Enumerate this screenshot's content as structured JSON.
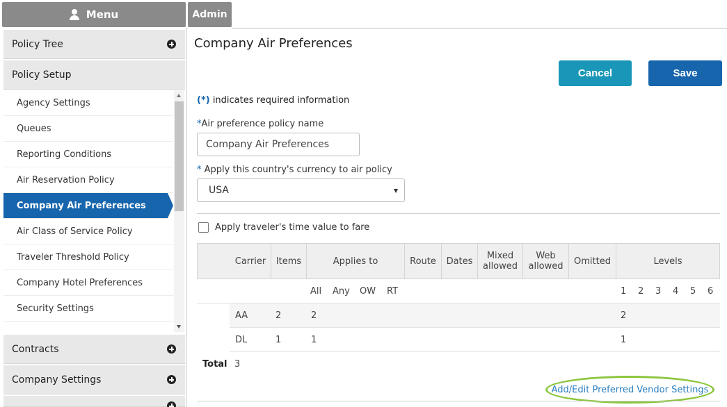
{
  "top": {
    "menu_label": "Menu",
    "admin_label": "Admin"
  },
  "sidebar": {
    "policy_tree": "Policy Tree",
    "policy_setup": "Policy Setup",
    "items": [
      "Agency Settings",
      "Queues",
      "Reporting Conditions",
      "Air Reservation Policy",
      "Company Air Preferences",
      "Air Class of Service Policy",
      "Traveler Threshold Policy",
      "Company Hotel Preferences",
      "Security Settings"
    ],
    "active_item": "Company Air Preferences",
    "contracts": "Contracts",
    "company_settings": "Company Settings"
  },
  "main": {
    "title": "Company Air Preferences",
    "cancel_label": "Cancel",
    "save_label": "Save",
    "required_star": "(*)",
    "required_note": " indicates required information",
    "policy_name_label": "Air preference policy name",
    "policy_name_value": "Company Air Preferences",
    "currency_label": " Apply this country's currency to air policy",
    "currency_value": "USA",
    "time_value_label": "Apply traveler's time value to fare",
    "table": {
      "headers": {
        "carrier": "Carrier",
        "items": "Items",
        "applies_to": "Applies to",
        "route": "Route",
        "dates": "Dates",
        "mixed": "Mixed allowed",
        "web": "Web allowed",
        "omitted": "Omitted",
        "levels": "Levels"
      },
      "applies_sub": [
        "All",
        "Any",
        "OW",
        "RT"
      ],
      "level_sub": [
        "1",
        "2",
        "3",
        "4",
        "5",
        "6"
      ],
      "rows": [
        {
          "carrier": "AA",
          "items": "2",
          "all": "2",
          "level1": "2"
        },
        {
          "carrier": "DL",
          "items": "1",
          "all": "1",
          "level1": "1"
        }
      ]
    },
    "total_label": "Total",
    "total_value": "3",
    "vendor_link": "Add/Edit Preferred Vendor Settings"
  }
}
